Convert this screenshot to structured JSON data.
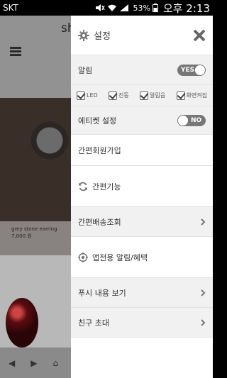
{
  "status_bar": {
    "carrier": "SKT",
    "battery": "53%",
    "time": "오후 2:13"
  },
  "background_app": {
    "title": "sh",
    "product_caption": "grey stone earring",
    "product_price": "7,000 원"
  },
  "drawer": {
    "title": "설정",
    "notification": {
      "label": "알림",
      "toggle": "YES"
    },
    "notification_options": [
      {
        "label": "LED"
      },
      {
        "label": "진동"
      },
      {
        "label": "알림음"
      },
      {
        "label": "화면켜짐"
      }
    ],
    "etiquette": {
      "label": "에티켓 설정",
      "toggle": "NO"
    },
    "simple_signup": "간편회원가입",
    "simple_function": "간편기능",
    "simple_shipping": "간편배송조회",
    "app_notifications": "앱전용 알림/혜택",
    "push_view": "푸시 내용 보기",
    "invite_friends": "친구 초대"
  }
}
